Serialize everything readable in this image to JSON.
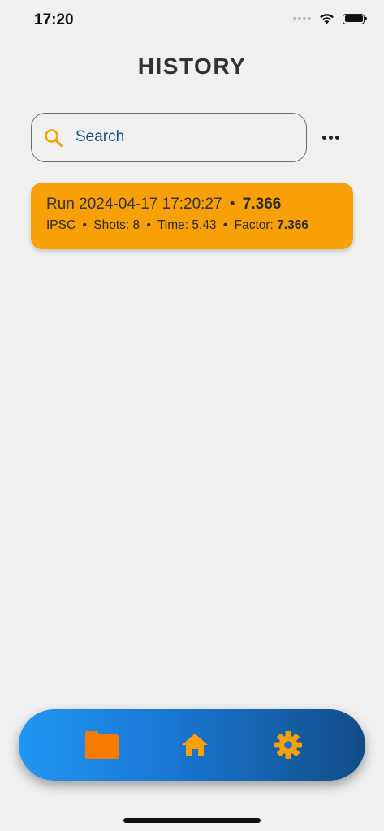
{
  "status_bar": {
    "time": "17:20"
  },
  "page": {
    "title": "HISTORY"
  },
  "search": {
    "placeholder": "Search",
    "value": ""
  },
  "history": [
    {
      "title_prefix": "Run 2024-04-17 17:20:27",
      "separator": "•",
      "score": "7.366",
      "division": "IPSC",
      "shots": "Shots: 8",
      "time": "Time: 5.43",
      "factor_label": "Factor:",
      "factor_value": "7.366"
    }
  ],
  "nav": {
    "items": [
      {
        "icon": "folder-icon",
        "active": true
      },
      {
        "icon": "home-icon",
        "active": false
      },
      {
        "icon": "gear-icon",
        "active": false
      }
    ]
  },
  "colors": {
    "accent": "#f9a006",
    "active_icon": "#f57c00",
    "nav_gradient_start": "#2196f3",
    "nav_gradient_end": "#114d86",
    "search_text": "#1f4e79"
  }
}
